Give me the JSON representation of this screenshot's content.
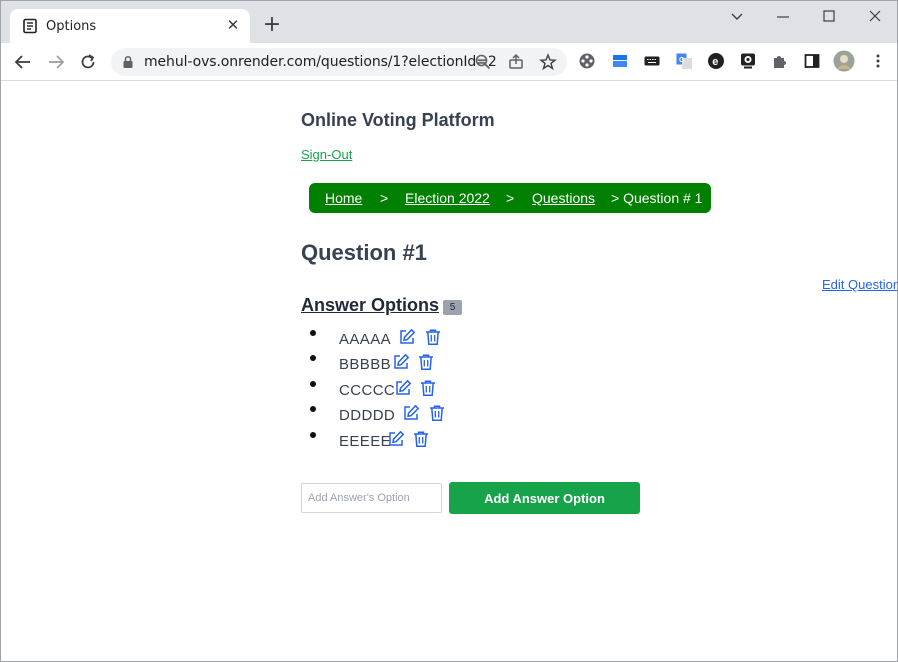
{
  "browser": {
    "tab": {
      "title": "Options",
      "favicon": "document-icon"
    },
    "url": "mehul-ovs.onrender.com/questions/1?electionId=2",
    "extensions": [
      "film-reel-icon",
      "storage-icon",
      "keyboard-icon",
      "translate-icon",
      "e-icon",
      "webcam-icon",
      "puzzle-icon",
      "sidepanel-icon",
      "profile-avatar",
      "kebab-menu-icon"
    ]
  },
  "header": {
    "site_title": "Online Voting Platform",
    "signout_label": "Sign-Out"
  },
  "breadcrumb": {
    "home": "Home",
    "sep1": ">",
    "election": "Election 2022",
    "sep2": ">",
    "questions": "Questions",
    "current": "> Question # 1"
  },
  "main": {
    "heading": "Question #1",
    "edit_question_label": "Edit Question",
    "answers_heading": "Answer Options",
    "answer_count": "5",
    "options": [
      {
        "label": "AAAAA"
      },
      {
        "label": "BBBBB"
      },
      {
        "label": "CCCCC"
      },
      {
        "label": "DDDDD"
      },
      {
        "label": "EEEEE"
      }
    ],
    "input_placeholder": "Add Answer's Option",
    "add_button_label": "Add Answer Option"
  },
  "colors": {
    "breadcrumb_bg": "#008000",
    "primary_green": "#16a34a",
    "link_blue": "#2563eb",
    "icon_blue": "#2563eb"
  }
}
